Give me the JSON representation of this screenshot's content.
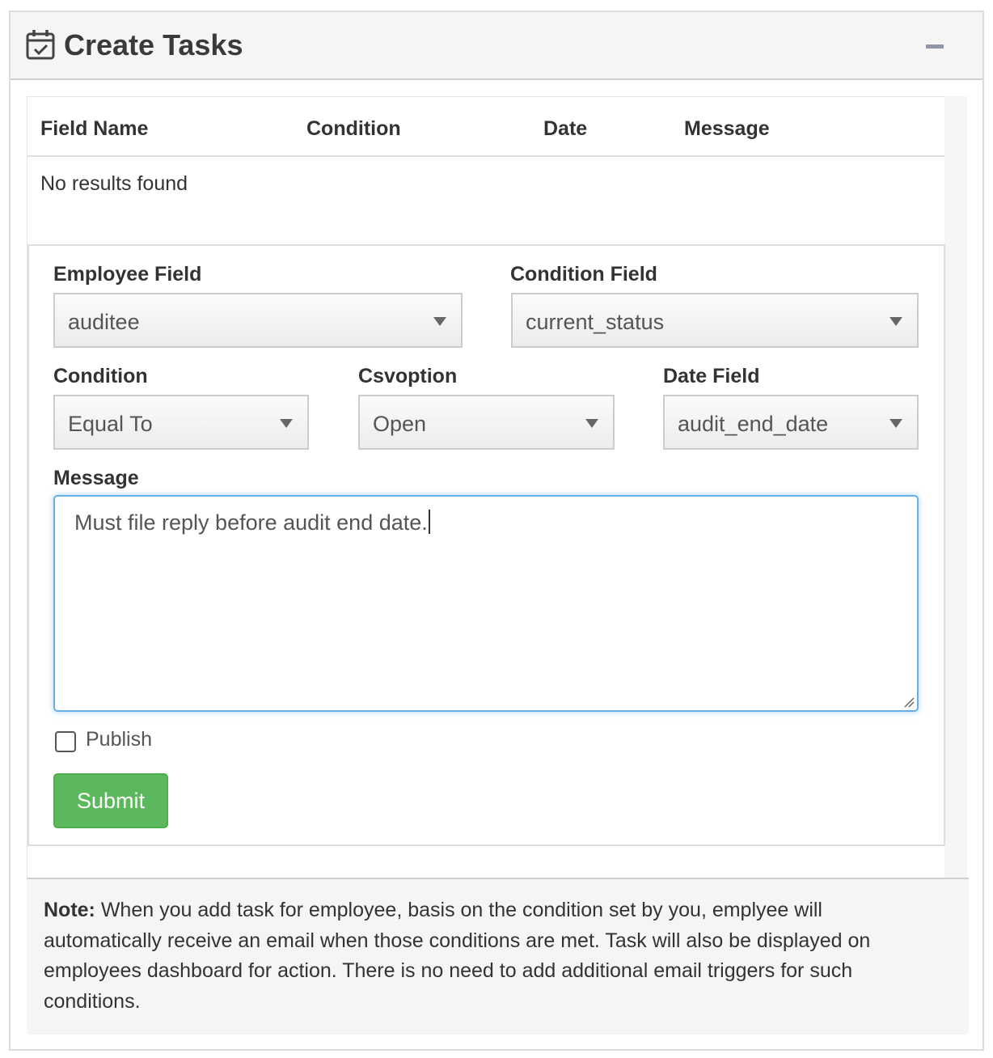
{
  "panel": {
    "title": "Create Tasks",
    "icon": "calendar-check-icon",
    "collapse_icon": "minus-icon"
  },
  "table": {
    "columns": [
      "Field Name",
      "Condition",
      "Date",
      "Message"
    ],
    "empty_text": "No results found"
  },
  "form": {
    "employee_field": {
      "label": "Employee Field",
      "value": "auditee"
    },
    "condition_field": {
      "label": "Condition Field",
      "value": "current_status"
    },
    "condition": {
      "label": "Condition",
      "value": "Equal To"
    },
    "csvoption": {
      "label": "Csvoption",
      "value": "Open"
    },
    "date_field": {
      "label": "Date Field",
      "value": "audit_end_date"
    },
    "message": {
      "label": "Message",
      "value": "Must file reply before audit end date."
    },
    "publish": {
      "label": "Publish",
      "checked": false
    },
    "submit_label": "Submit"
  },
  "note": {
    "prefix": "Note:",
    "text": " When you add task for employee, basis on the condition set by you, emplyee will automatically receive an email when those conditions are met. Task will also be displayed on employees dashboard for action. There is no need to add additional email triggers for such conditions."
  },
  "colors": {
    "submit": "#5cb85c",
    "focus_border": "#66afe9",
    "header_bg": "#f5f5f5"
  }
}
